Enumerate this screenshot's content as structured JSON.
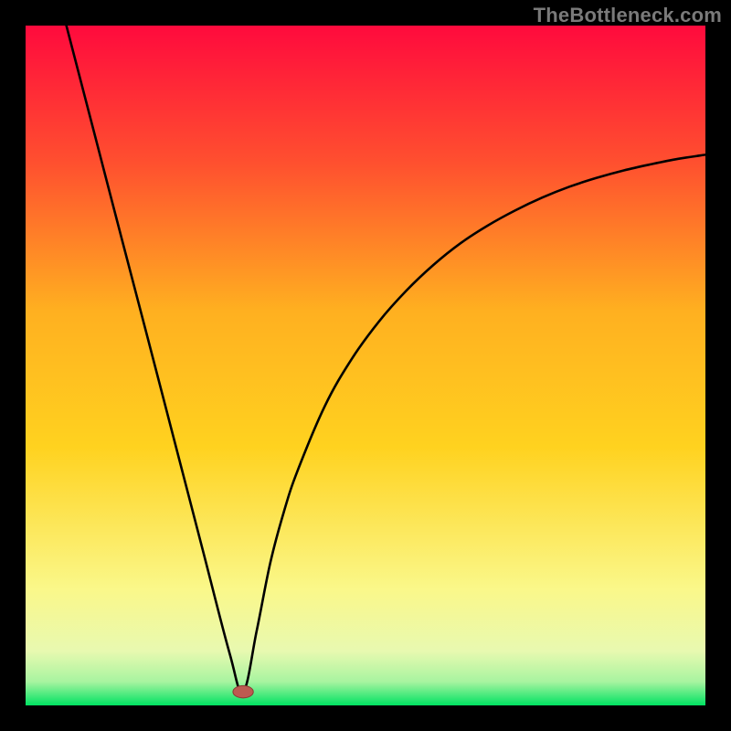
{
  "attribution": "TheBottleneck.com",
  "colors": {
    "frame": "#000000",
    "grad_top": "#ff0a3d",
    "grad_upper": "#ff5f2b",
    "grad_mid": "#ffd21f",
    "grad_lower": "#f6f78e",
    "grad_pale": "#c8f7a8",
    "grad_green": "#00e262",
    "curve": "#000000",
    "marker_fill": "#bd5a51",
    "marker_stroke": "#8a3a33"
  },
  "chart_data": {
    "type": "line",
    "title": "",
    "xlabel": "",
    "ylabel": "",
    "xlim": [
      0,
      100
    ],
    "ylim": [
      0,
      100
    ],
    "series": [
      {
        "name": "bottleneck-curve",
        "x_vertex": 32,
        "left_top_x": 6,
        "right_end_y": 81,
        "note": "V-shaped curve: steep linear-ish left arm from top-left to the minimum, then rising concave right arm flattening toward the right edge. Values estimated from pixel positions; ylim 0–100 with 0 at bottom.",
        "x": [
          6,
          10,
          14,
          18,
          22,
          26,
          30,
          32,
          34,
          36,
          38,
          40,
          44,
          48,
          52,
          56,
          60,
          64,
          68,
          72,
          76,
          80,
          84,
          88,
          92,
          96,
          100
        ],
        "y": [
          100,
          84.6,
          69.2,
          53.9,
          38.5,
          23.1,
          7.7,
          2.0,
          11.0,
          21.0,
          28.5,
          34.5,
          44.0,
          51.0,
          56.5,
          61.0,
          64.8,
          68.0,
          70.6,
          72.8,
          74.7,
          76.3,
          77.6,
          78.7,
          79.6,
          80.4,
          81.0
        ]
      }
    ],
    "marker": {
      "name": "optimal-point",
      "x": 32,
      "y": 2,
      "rx": 1.5,
      "ry": 0.9
    }
  }
}
